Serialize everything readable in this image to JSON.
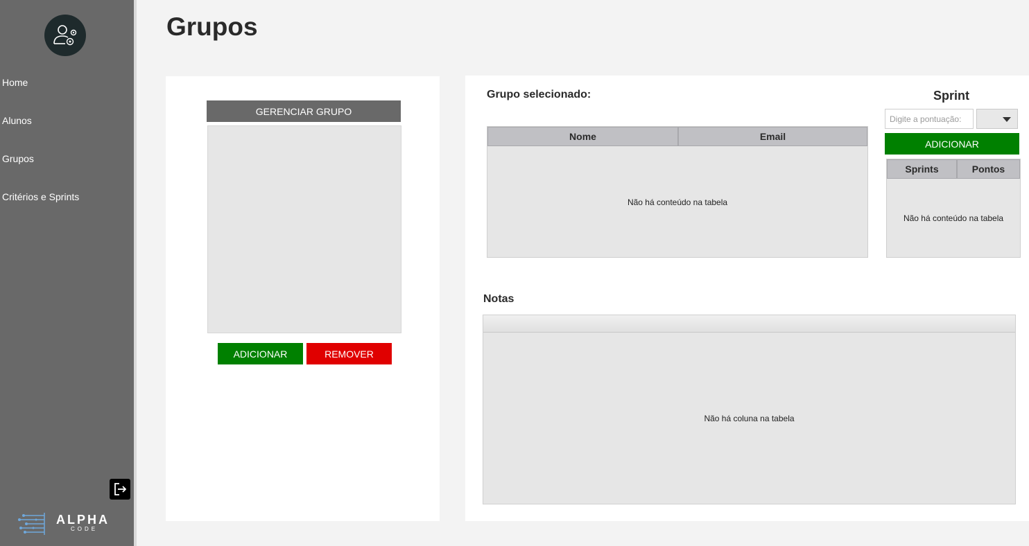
{
  "sidebar": {
    "nav": [
      "Home",
      "Alunos",
      "Grupos",
      "Critérios e Sprints"
    ],
    "brand": {
      "name": "ALPHA",
      "sub": "CODE"
    }
  },
  "page": {
    "title": "Grupos"
  },
  "left_panel": {
    "manage_button": "GERENCIAR GRUPO",
    "add_button": "ADICIONAR",
    "remove_button": "REMOVER"
  },
  "group_panel": {
    "selected_label": "Grupo selecionado:",
    "members_table": {
      "columns": [
        "Nome",
        "Email"
      ],
      "empty_text": "Não há conteúdo na tabela"
    }
  },
  "sprint_panel": {
    "title": "Sprint",
    "score_placeholder": "Digite a pontuação:",
    "add_button": "ADICIONAR",
    "table": {
      "columns": [
        "Sprints",
        "Pontos"
      ],
      "empty_text": "Não há conteúdo na tabela"
    }
  },
  "notes_panel": {
    "title": "Notas",
    "empty_text": "Não há coluna na tabela"
  },
  "colors": {
    "sidebar": "#696969",
    "primary_green": "#008000",
    "danger_red": "#e00000",
    "table_header": "#c0c0c4"
  }
}
